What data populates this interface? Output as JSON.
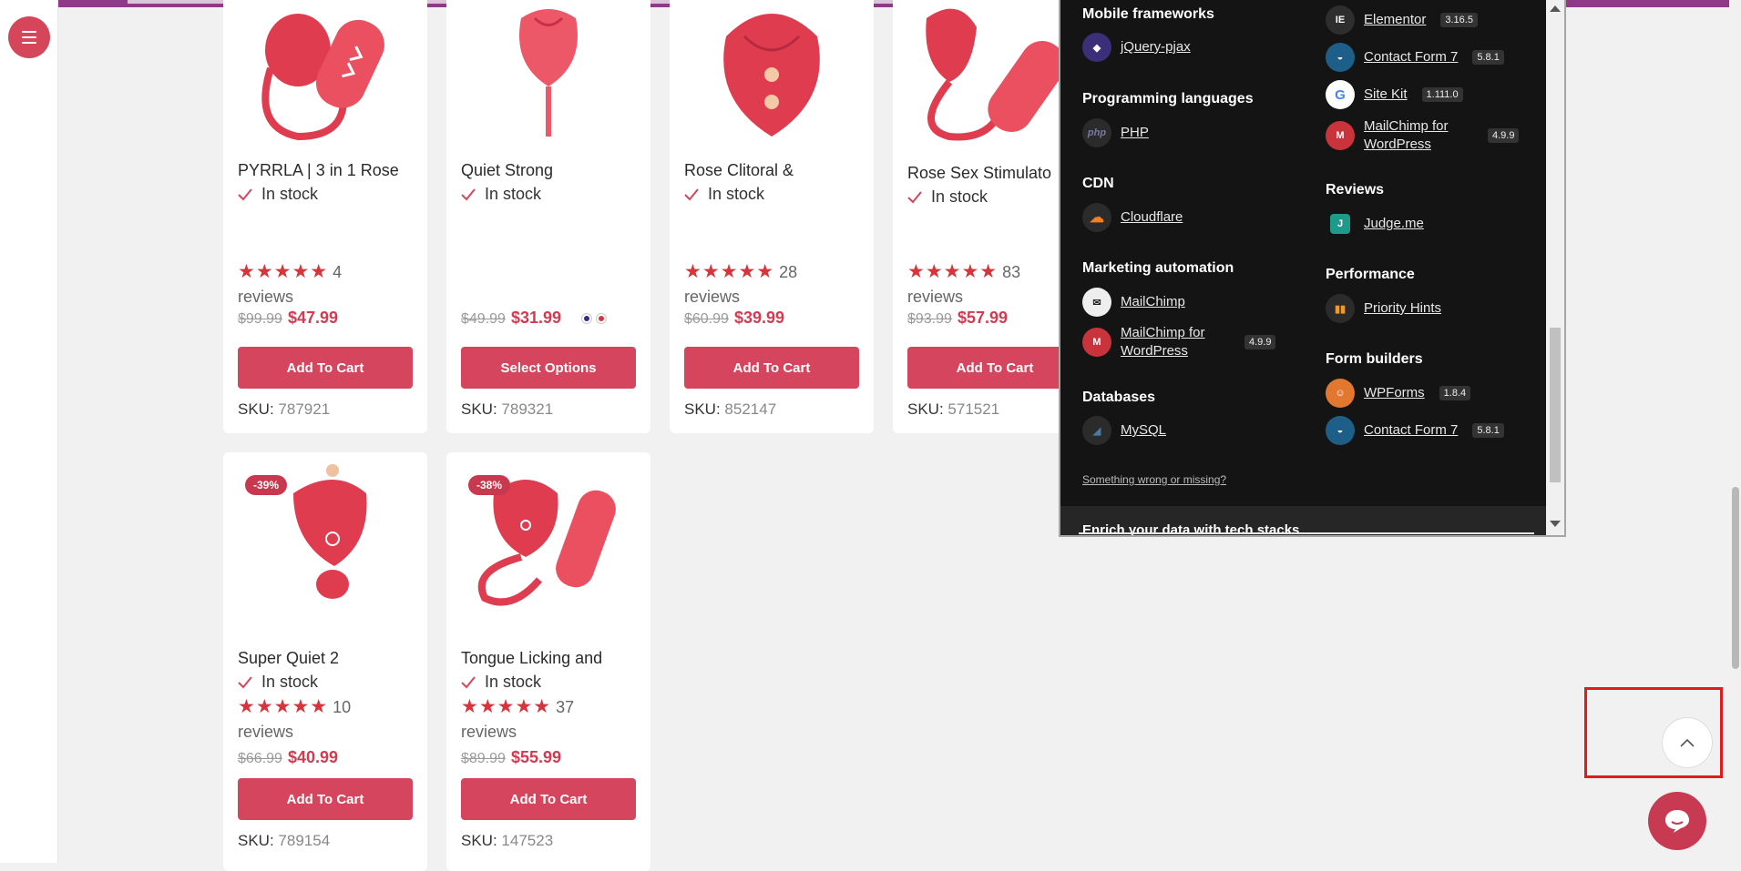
{
  "products": [
    {
      "title": "PYRRLA | 3 in 1 Rose",
      "stock": "In stock",
      "reviews_count": "4",
      "reviews_word": "reviews",
      "rating": 5,
      "old_price": "$99.99",
      "new_price": "$47.99",
      "button": "Add To Cart",
      "sku_label": "SKU:",
      "sku": "787921"
    },
    {
      "title": "Quiet Strong",
      "stock": "In stock",
      "old_price": "$49.99",
      "new_price": "$31.99",
      "button": "Select Options",
      "sku_label": "SKU:",
      "sku": "789321",
      "swatches": [
        "#3a2a8c",
        "#d8343c"
      ]
    },
    {
      "title": "Rose Clitoral &",
      "stock": "In stock",
      "reviews_count": "28",
      "reviews_word": "reviews",
      "rating": 5,
      "old_price": "$60.99",
      "new_price": "$39.99",
      "button": "Add To Cart",
      "sku_label": "SKU:",
      "sku": "852147"
    },
    {
      "title": "Rose Sex Stimulato",
      "stock": "In stock",
      "reviews_count": "83",
      "reviews_word": "reviews",
      "rating": 5,
      "old_price": "$93.99",
      "new_price": "$57.99",
      "button": "Add To Cart",
      "sku_label": "SKU:",
      "sku": "571521"
    },
    {
      "badge": "-39%",
      "title": "Super Quiet 2",
      "stock": "In stock",
      "reviews_count": "10",
      "reviews_word": "reviews",
      "rating": 5,
      "old_price": "$66.99",
      "new_price": "$40.99",
      "button": "Add To Cart",
      "sku_label": "SKU:",
      "sku": "789154"
    },
    {
      "badge": "-38%",
      "title": "Tongue Licking and",
      "stock": "In stock",
      "reviews_count": "37",
      "reviews_word": "reviews",
      "rating": 5,
      "old_price": "$89.99",
      "new_price": "$55.99",
      "button": "Add To Cart",
      "sku_label": "SKU:",
      "sku": "147523"
    }
  ],
  "tech": {
    "groups_left": [
      {
        "name": "Mobile frameworks",
        "items": [
          {
            "label": "jQuery-pjax",
            "icon": "pjax-icon"
          }
        ]
      },
      {
        "name": "Programming languages",
        "items": [
          {
            "label": "PHP",
            "icon": "php-icon"
          }
        ]
      },
      {
        "name": "CDN",
        "items": [
          {
            "label": "Cloudflare",
            "icon": "cloudflare-icon"
          }
        ]
      },
      {
        "name": "Marketing automation",
        "items": [
          {
            "label": "MailChimp",
            "icon": "mailchimp-icon"
          },
          {
            "label": "MailChimp for WordPress",
            "version": "4.9.9",
            "icon": "mc4wp-icon"
          }
        ]
      },
      {
        "name": "Databases",
        "items": [
          {
            "label": "MySQL",
            "icon": "mysql-icon"
          }
        ]
      }
    ],
    "groups_right": [
      {
        "name": "",
        "items": [
          {
            "label": "Elementor",
            "version": "3.16.5",
            "icon": "elementor-icon"
          },
          {
            "label": "Contact Form 7",
            "version": "5.8.1",
            "icon": "contact-form-icon"
          },
          {
            "label": "Site Kit",
            "version": "1.111.0",
            "icon": "google-icon"
          },
          {
            "label": "MailChimp for WordPress",
            "version": "4.9.9",
            "icon": "mc4wp-icon"
          }
        ]
      },
      {
        "name": "Reviews",
        "items": [
          {
            "label": "Judge.me",
            "icon": "judgeme-icon"
          }
        ]
      },
      {
        "name": "Performance",
        "items": [
          {
            "label": "Priority Hints",
            "icon": "priority-hints-icon"
          }
        ]
      },
      {
        "name": "Form builders",
        "items": [
          {
            "label": "WPForms",
            "version": "1.8.4",
            "icon": "wpforms-icon"
          },
          {
            "label": "Contact Form 7",
            "version": "5.8.1",
            "icon": "contact-form-icon"
          }
        ]
      }
    ],
    "wrong_link": "Something wrong or missing?",
    "footer_text": "Enrich your data with tech stacks"
  }
}
